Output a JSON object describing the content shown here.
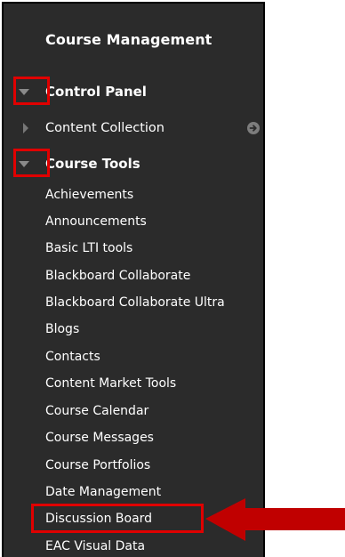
{
  "panel": {
    "title": "Course Management",
    "control_panel": {
      "label": "Control Panel"
    },
    "content_collection": {
      "label": "Content Collection"
    },
    "course_tools": {
      "label": "Course Tools",
      "items": [
        "Achievements",
        "Announcements",
        "Basic LTI tools",
        "Blackboard Collaborate",
        "Blackboard Collaborate Ultra",
        "Blogs",
        "Contacts",
        "Content Market Tools",
        "Course Calendar",
        "Course Messages",
        "Course Portfolios",
        "Date Management",
        "Discussion Board",
        "EAC Visual Data"
      ]
    }
  },
  "colors": {
    "panel_bg": "#2b2b2b",
    "highlight": "#e00000",
    "arrow": "#c00000"
  },
  "icons": {
    "expanded": "triangle-down-icon",
    "collapsed": "triangle-right-icon",
    "go": "arrow-right-circle-icon"
  },
  "annotation": {
    "highlighted_item": "Discussion Board"
  }
}
